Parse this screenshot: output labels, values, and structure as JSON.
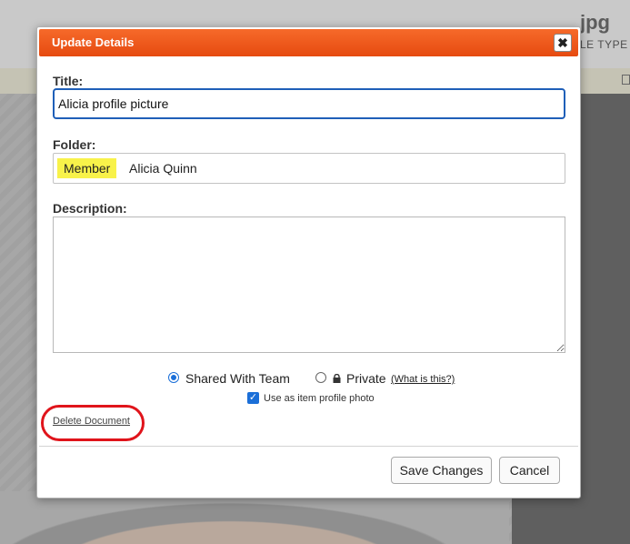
{
  "background": {
    "file_extension": "jpg",
    "file_type_label": "LE TYPE"
  },
  "dialog": {
    "title": "Update Details",
    "close_symbol": "✖",
    "title_label": "Title:",
    "title_value": "Alicia profile picture",
    "folder_label": "Folder:",
    "folder_tag": "Member",
    "folder_name": "Alicia Quinn",
    "description_label": "Description:",
    "description_value": "",
    "sharing": {
      "shared_label": "Shared With Team",
      "private_label": "Private",
      "what_link": "(What is this?)",
      "selected": "shared"
    },
    "profile_photo_label": "Use as item profile photo",
    "profile_photo_checked": true,
    "delete_link": "Delete Document",
    "save_button": "Save Changes",
    "cancel_button": "Cancel"
  },
  "colors": {
    "header": "#ee5418",
    "accent_blue": "#1b6fd8",
    "tag_highlight": "#f8f24a",
    "annotation": "#e0141b"
  }
}
